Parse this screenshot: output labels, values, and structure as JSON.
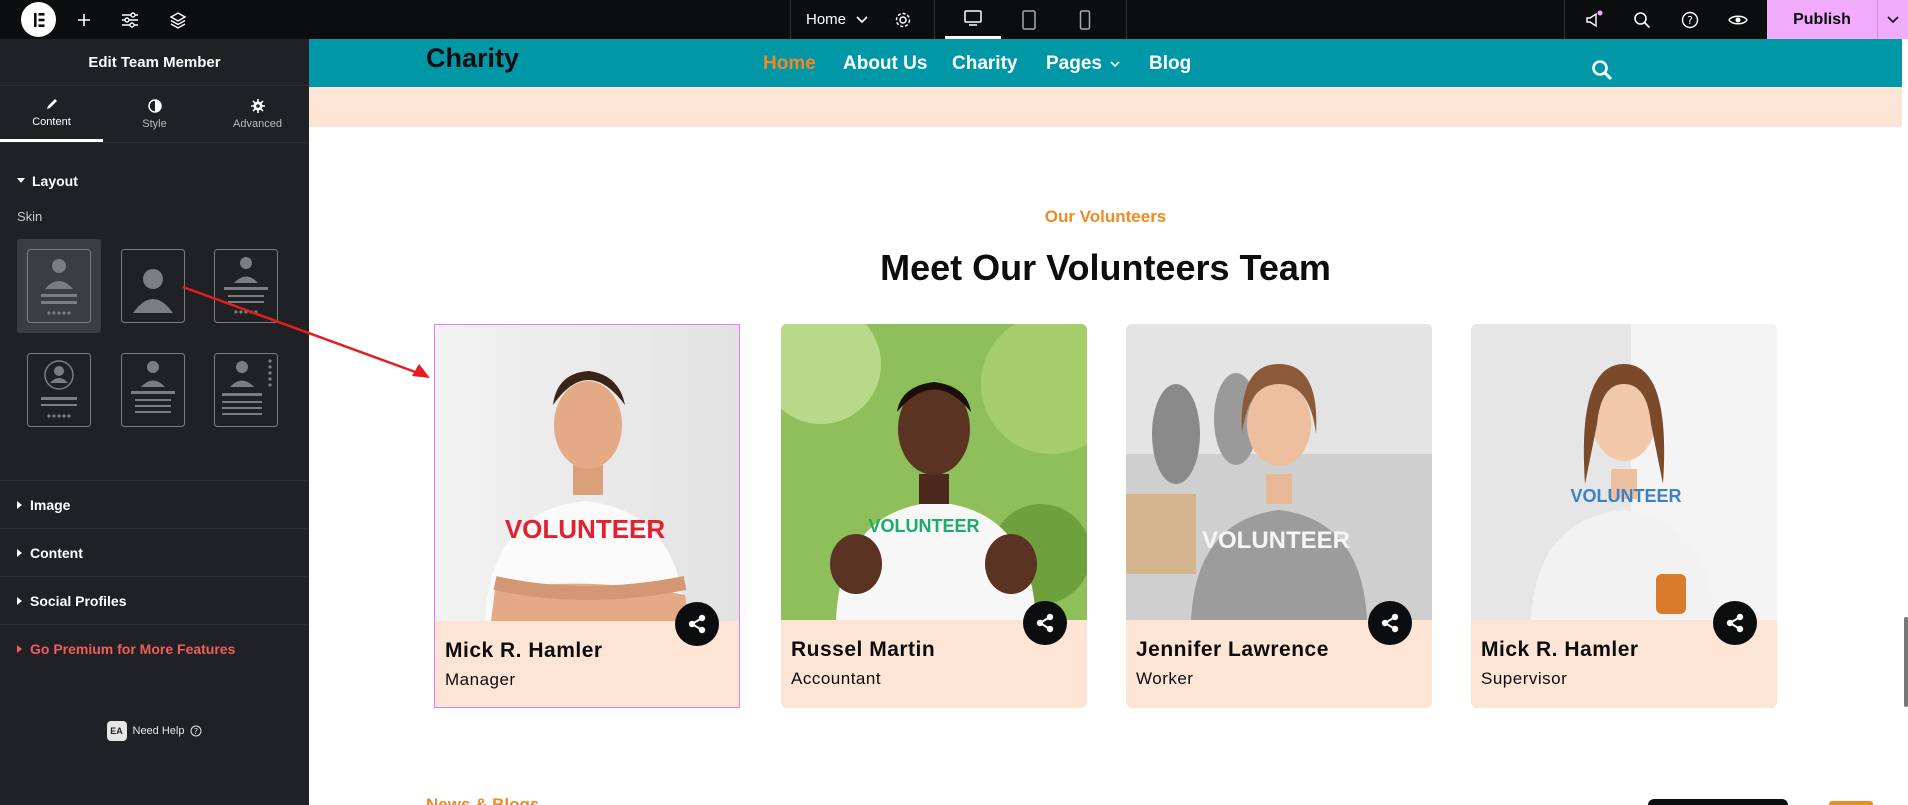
{
  "topbar": {
    "logo_icon": "elementor-logo-icon",
    "page_selector": "Home",
    "publish_label": "Publish",
    "icons": [
      "plus-icon",
      "sliders-icon",
      "layers-icon",
      "settings-icon",
      "desktop-icon",
      "tablet-icon",
      "mobile-icon",
      "megaphone-icon",
      "search-icon",
      "help-icon",
      "eye-icon",
      "chevron-down-icon"
    ]
  },
  "sidebar": {
    "title": "Edit Team Member",
    "tabs": [
      {
        "label": "Content",
        "icon": "pencil-icon",
        "active": true
      },
      {
        "label": "Style",
        "icon": "half-circle-icon"
      },
      {
        "label": "Advanced",
        "icon": "gear-icon"
      }
    ],
    "layout_label": "Layout",
    "skin_label": "Skin",
    "sections": [
      "Image",
      "Content",
      "Social Profiles"
    ],
    "premium_label": "Go Premium for More Features",
    "help_label": "Need Help"
  },
  "site": {
    "brand": "Charity",
    "nav": [
      {
        "label": "Home",
        "active": true
      },
      {
        "label": "About Us"
      },
      {
        "label": "Charity"
      },
      {
        "label": "Pages"
      },
      {
        "label": "Blog"
      }
    ],
    "kicker": "Our Volunteers",
    "headline": "Meet Our Volunteers Team",
    "members": [
      {
        "name": "Mick R. Hamler",
        "role": "Manager",
        "shirt_text": "VOLUNTEER"
      },
      {
        "name": "Russel Martin",
        "role": "Accountant",
        "shirt_text": "VOLUNTEER"
      },
      {
        "name": "Jennifer Lawrence",
        "role": "Worker",
        "shirt_text": "VOLUNTEER"
      },
      {
        "name": "Mick R. Hamler",
        "role": "Supervisor",
        "shirt_text": "VOLUNTEER"
      }
    ],
    "next_section_kicker": "News & Blogs"
  },
  "colors": {
    "accent": "#f08a24",
    "header_teal": "#0097a7",
    "peach": "#fde5d5",
    "publish_pink": "#f0abfc",
    "premium_red": "#f25c5c"
  }
}
